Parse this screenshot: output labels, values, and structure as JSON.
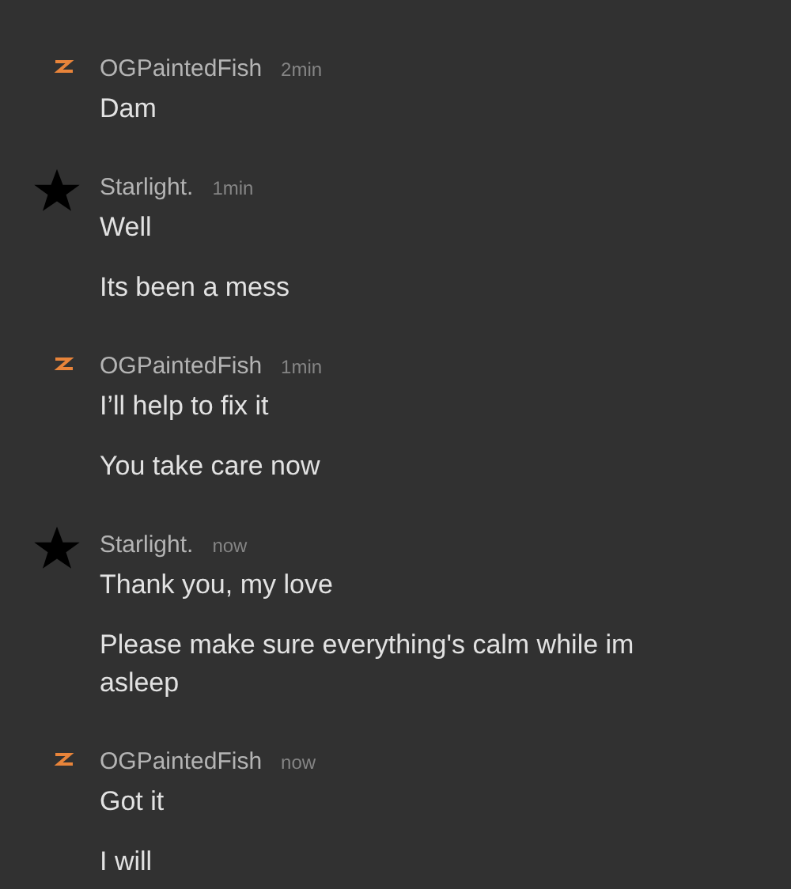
{
  "messages": [
    {
      "kind": "bolt",
      "author": "OGPaintedFish",
      "time": "2min",
      "lines": [
        "Dam"
      ]
    },
    {
      "kind": "star",
      "author": "Starlight.",
      "time": "1min",
      "lines": [
        "Well",
        "Its been a mess"
      ]
    },
    {
      "kind": "bolt",
      "author": "OGPaintedFish",
      "time": "1min",
      "lines": [
        "I’ll help to fix it",
        "You take care now"
      ]
    },
    {
      "kind": "star",
      "author": "Starlight.",
      "time": "now",
      "lines": [
        "Thank you, my love",
        "Please make sure everything's calm while im asleep"
      ]
    },
    {
      "kind": "bolt",
      "author": "OGPaintedFish",
      "time": "now",
      "lines": [
        "Got it",
        "I will"
      ]
    }
  ]
}
